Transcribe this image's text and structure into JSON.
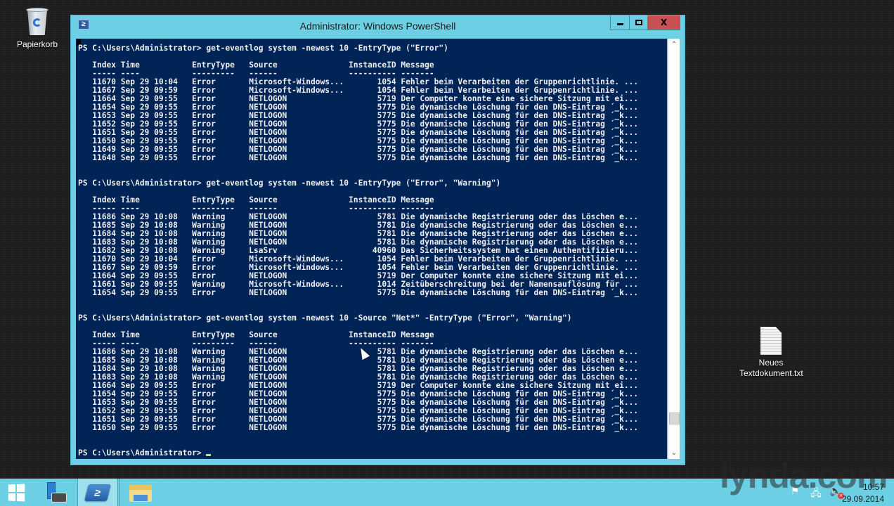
{
  "desktop": {
    "icons": [
      {
        "label": "Papierkorb",
        "icon": "recycle-bin-icon"
      },
      {
        "label": "Neues\nTextdokument.txt",
        "icon": "text-file-icon"
      }
    ]
  },
  "window": {
    "title": "Administrator: Windows PowerShell",
    "app_icon": "powershell-icon",
    "app_icon_glyph": "≥",
    "controls": {
      "minimize": "minimize",
      "maximize": "maximize",
      "close_label": "X"
    },
    "accent": "#6ccfe3",
    "console_bg": "#012456",
    "console_fg": "#eeedf0"
  },
  "console": {
    "prompt": "PS C:\\Users\\Administrator>",
    "headers": [
      "Index",
      "Time",
      "EntryType",
      "Source",
      "InstanceID",
      "Message"
    ],
    "blocks": [
      {
        "command": "get-eventlog system -newest 10 -EntryType (\"Error\")",
        "rows": [
          [
            "11670",
            "Sep 29 10:04",
            "Error",
            "Microsoft-Windows...",
            "1054",
            "Fehler beim Verarbeiten der Gruppenrichtlinie. ..."
          ],
          [
            "11667",
            "Sep 29 09:59",
            "Error",
            "Microsoft-Windows...",
            "1054",
            "Fehler beim Verarbeiten der Gruppenrichtlinie. ..."
          ],
          [
            "11664",
            "Sep 29 09:55",
            "Error",
            "NETLOGON",
            "5719",
            "Der Computer konnte eine sichere Sitzung mit ei..."
          ],
          [
            "11654",
            "Sep 29 09:55",
            "Error",
            "NETLOGON",
            "5775",
            "Die dynamische Löschung für den DNS-Eintrag ´_k..."
          ],
          [
            "11653",
            "Sep 29 09:55",
            "Error",
            "NETLOGON",
            "5775",
            "Die dynamische Löschung für den DNS-Eintrag ´_k..."
          ],
          [
            "11652",
            "Sep 29 09:55",
            "Error",
            "NETLOGON",
            "5775",
            "Die dynamische Löschung für den DNS-Eintrag ´_k..."
          ],
          [
            "11651",
            "Sep 29 09:55",
            "Error",
            "NETLOGON",
            "5775",
            "Die dynamische Löschung für den DNS-Eintrag ´_k..."
          ],
          [
            "11650",
            "Sep 29 09:55",
            "Error",
            "NETLOGON",
            "5775",
            "Die dynamische Löschung für den DNS-Eintrag ´_k..."
          ],
          [
            "11649",
            "Sep 29 09:55",
            "Error",
            "NETLOGON",
            "5775",
            "Die dynamische Löschung für den DNS-Eintrag ´_k..."
          ],
          [
            "11648",
            "Sep 29 09:55",
            "Error",
            "NETLOGON",
            "5775",
            "Die dynamische Löschung für den DNS-Eintrag ´_k..."
          ]
        ]
      },
      {
        "command": "get-eventlog system -newest 10 -EntryType (\"Error\", \"Warning\")",
        "rows": [
          [
            "11686",
            "Sep 29 10:08",
            "Warning",
            "NETLOGON",
            "5781",
            "Die dynamische Registrierung oder das Löschen e..."
          ],
          [
            "11685",
            "Sep 29 10:08",
            "Warning",
            "NETLOGON",
            "5781",
            "Die dynamische Registrierung oder das Löschen e..."
          ],
          [
            "11684",
            "Sep 29 10:08",
            "Warning",
            "NETLOGON",
            "5781",
            "Die dynamische Registrierung oder das Löschen e..."
          ],
          [
            "11683",
            "Sep 29 10:08",
            "Warning",
            "NETLOGON",
            "5781",
            "Die dynamische Registrierung oder das Löschen e..."
          ],
          [
            "11682",
            "Sep 29 10:08",
            "Warning",
            "LsaSrv",
            "40960",
            "Das Sicherheitssystem hat einen Authentifizieru..."
          ],
          [
            "11670",
            "Sep 29 10:04",
            "Error",
            "Microsoft-Windows...",
            "1054",
            "Fehler beim Verarbeiten der Gruppenrichtlinie. ..."
          ],
          [
            "11667",
            "Sep 29 09:59",
            "Error",
            "Microsoft-Windows...",
            "1054",
            "Fehler beim Verarbeiten der Gruppenrichtlinie. ..."
          ],
          [
            "11664",
            "Sep 29 09:55",
            "Error",
            "NETLOGON",
            "5719",
            "Der Computer konnte eine sichere Sitzung mit ei..."
          ],
          [
            "11661",
            "Sep 29 09:55",
            "Warning",
            "Microsoft-Windows...",
            "1014",
            "Zeitüberschreitung bei der Namensauflösung für ..."
          ],
          [
            "11654",
            "Sep 29 09:55",
            "Error",
            "NETLOGON",
            "5775",
            "Die dynamische Löschung für den DNS-Eintrag ´_k..."
          ]
        ]
      },
      {
        "command": "get-eventlog system -newest 10 -Source \"Net*\" -EntryType (\"Error\", \"Warning\")",
        "rows": [
          [
            "11686",
            "Sep 29 10:08",
            "Warning",
            "NETLOGON",
            "5781",
            "Die dynamische Registrierung oder das Löschen e..."
          ],
          [
            "11685",
            "Sep 29 10:08",
            "Warning",
            "NETLOGON",
            "5781",
            "Die dynamische Registrierung oder das Löschen e..."
          ],
          [
            "11684",
            "Sep 29 10:08",
            "Warning",
            "NETLOGON",
            "5781",
            "Die dynamische Registrierung oder das Löschen e..."
          ],
          [
            "11683",
            "Sep 29 10:08",
            "Warning",
            "NETLOGON",
            "5781",
            "Die dynamische Registrierung oder das Löschen e..."
          ],
          [
            "11664",
            "Sep 29 09:55",
            "Error",
            "NETLOGON",
            "5719",
            "Der Computer konnte eine sichere Sitzung mit ei..."
          ],
          [
            "11654",
            "Sep 29 09:55",
            "Error",
            "NETLOGON",
            "5775",
            "Die dynamische Löschung für den DNS-Eintrag ´_k..."
          ],
          [
            "11653",
            "Sep 29 09:55",
            "Error",
            "NETLOGON",
            "5775",
            "Die dynamische Löschung für den DNS-Eintrag ´_k..."
          ],
          [
            "11652",
            "Sep 29 09:55",
            "Error",
            "NETLOGON",
            "5775",
            "Die dynamische Löschung für den DNS-Eintrag ´_k..."
          ],
          [
            "11651",
            "Sep 29 09:55",
            "Error",
            "NETLOGON",
            "5775",
            "Die dynamische Löschung für den DNS-Eintrag ´_k..."
          ],
          [
            "11650",
            "Sep 29 09:55",
            "Error",
            "NETLOGON",
            "5775",
            "Die dynamische Löschung für den DNS-Eintrag ´_k..."
          ]
        ]
      }
    ],
    "scroll_position": 0.93
  },
  "scrollbar": {
    "up_glyph": "⌃",
    "down_glyph": "⌄"
  },
  "taskbar": {
    "items": [
      {
        "name": "start",
        "icon": "windows-logo-icon"
      },
      {
        "name": "server-manager",
        "icon": "server-manager-icon"
      },
      {
        "name": "powershell",
        "icon": "powershell-icon",
        "glyph": "≥",
        "active": true
      },
      {
        "name": "file-explorer",
        "icon": "folder-icon"
      }
    ],
    "tray": {
      "flag_glyph": "⚑",
      "network_glyph": "🖧",
      "volume_glyph": "🔈",
      "mute_glyph": "×",
      "time": "10:57",
      "date": "29.09.2014"
    }
  },
  "watermark": {
    "text": "lynda.com"
  }
}
